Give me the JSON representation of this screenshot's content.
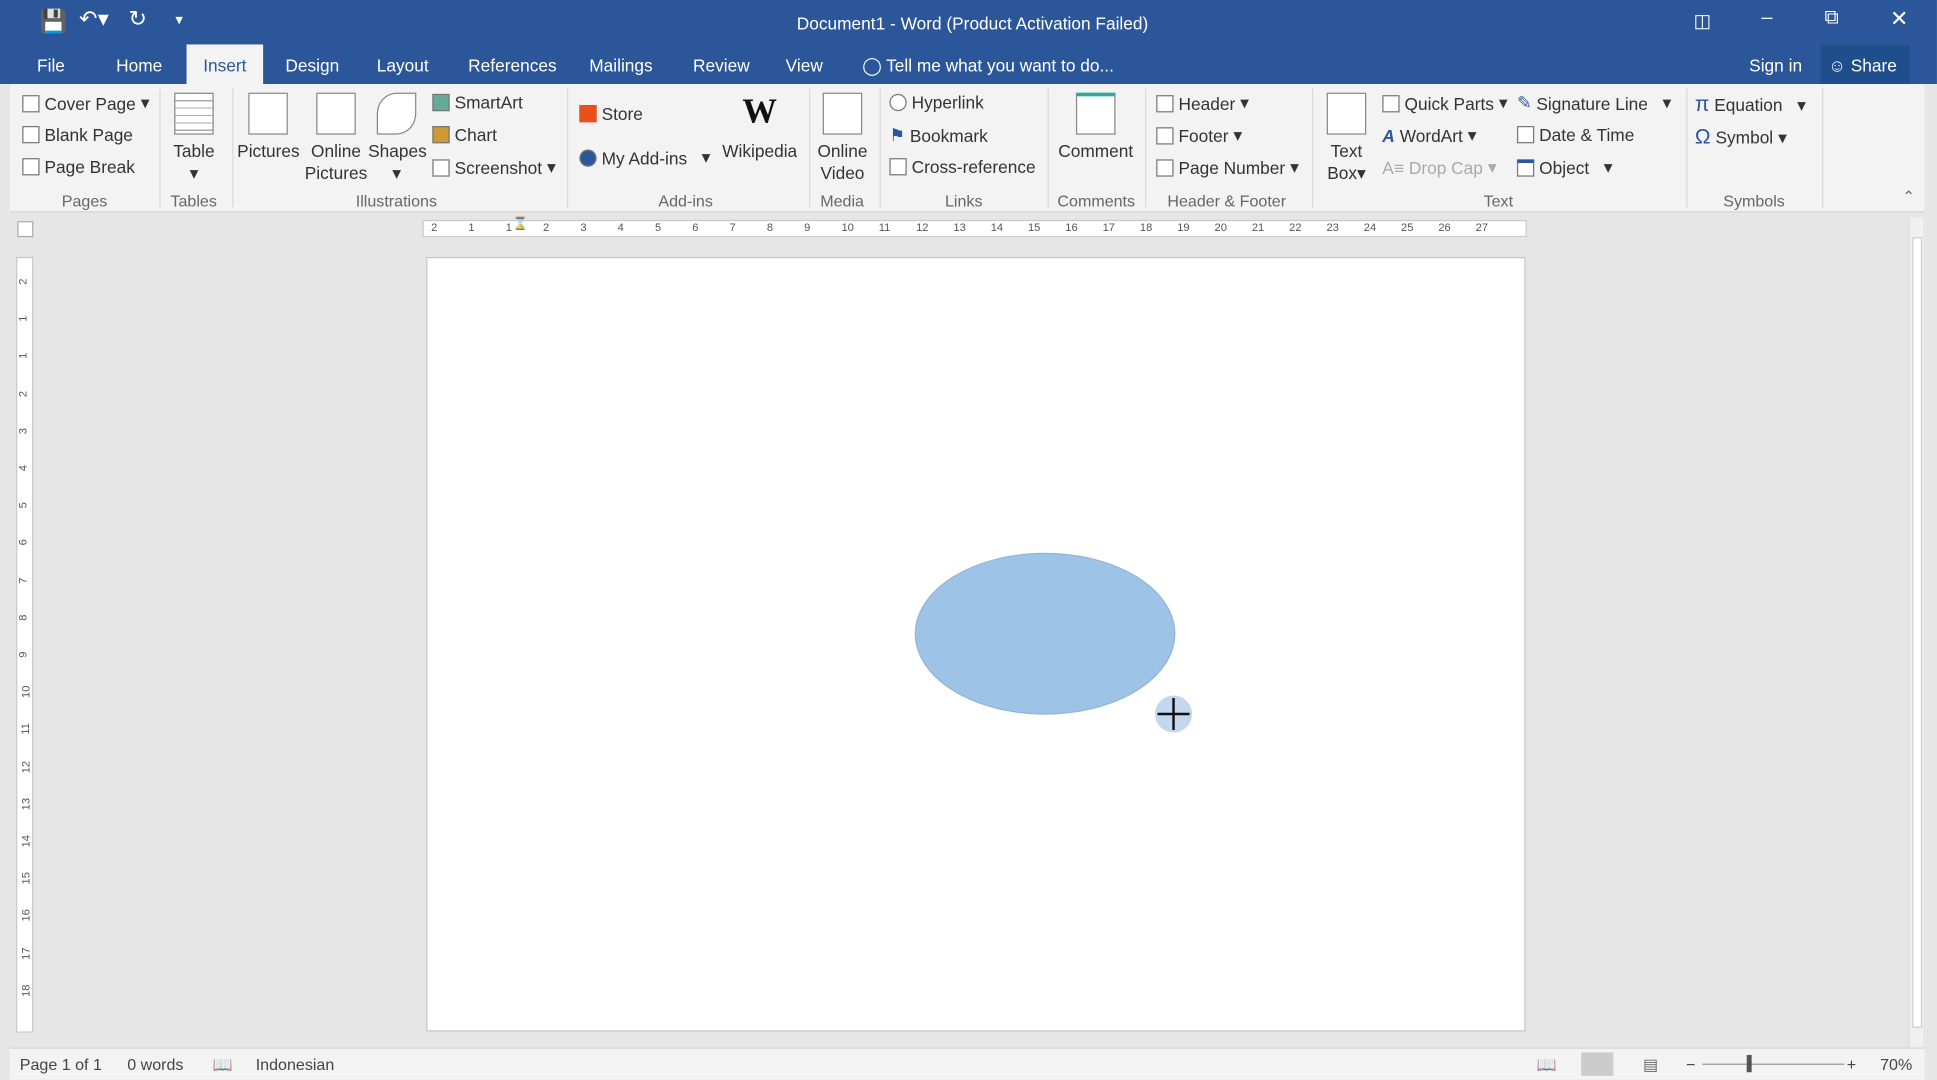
{
  "window": {
    "title": "Document1 - Word (Product Activation Failed)"
  },
  "quick_access": [
    "save-icon",
    "undo-icon",
    "redo-icon",
    "customize-icon"
  ],
  "tabs": [
    {
      "label": "File"
    },
    {
      "label": "Home"
    },
    {
      "label": "Insert",
      "active": true
    },
    {
      "label": "Design"
    },
    {
      "label": "Layout"
    },
    {
      "label": "References"
    },
    {
      "label": "Mailings"
    },
    {
      "label": "Review"
    },
    {
      "label": "View"
    }
  ],
  "tell_me": "Tell me what you want to do...",
  "sign_in": "Sign in",
  "share": "Share",
  "ribbon": {
    "pages": {
      "label": "Pages",
      "cover": "Cover Page",
      "blank": "Blank Page",
      "break": "Page Break"
    },
    "tables": {
      "label": "Tables",
      "table": "Table"
    },
    "illustrations": {
      "label": "Illustrations",
      "pictures": "Pictures",
      "online1": "Online",
      "online2": "Pictures",
      "shapes": "Shapes",
      "smartart": "SmartArt",
      "chart": "Chart",
      "screenshot": "Screenshot"
    },
    "addins": {
      "label": "Add-ins",
      "store": "Store",
      "myaddins": "My Add-ins",
      "wikipedia": "Wikipedia"
    },
    "media": {
      "label": "Media",
      "v1": "Online",
      "v2": "Video"
    },
    "links": {
      "label": "Links",
      "hyperlink": "Hyperlink",
      "bookmark": "Bookmark",
      "crossref": "Cross-reference"
    },
    "comments": {
      "label": "Comments",
      "comment": "Comment"
    },
    "hf": {
      "label": "Header & Footer",
      "header": "Header",
      "footer": "Footer",
      "pagenum": "Page Number"
    },
    "text": {
      "label": "Text",
      "tb1": "Text",
      "tb2": "Box",
      "quickparts": "Quick Parts",
      "wordart": "WordArt",
      "dropcap": "Drop Cap",
      "sigline": "Signature Line",
      "datetime": "Date & Time",
      "object": "Object"
    },
    "symbols": {
      "label": "Symbols",
      "equation": "Equation",
      "symbol": "Symbol"
    }
  },
  "ruler": {
    "h_ticks": [
      "2",
      "1",
      "1",
      "2",
      "3",
      "4",
      "5",
      "6",
      "7",
      "8",
      "9",
      "10",
      "11",
      "12",
      "13",
      "14",
      "15",
      "16",
      "17",
      "18",
      "19",
      "20",
      "21",
      "22",
      "23",
      "24",
      "25",
      "26",
      "27"
    ],
    "v_ticks": [
      "2",
      "1",
      "1",
      "2",
      "3",
      "4",
      "5",
      "6",
      "7",
      "8",
      "9",
      "10",
      "11",
      "12",
      "13",
      "14",
      "15",
      "16",
      "17",
      "18"
    ]
  },
  "document": {
    "shape": "oval",
    "shape_fill": "#9dc3e6"
  },
  "status": {
    "page": "Page 1 of 1",
    "words": "0 words",
    "language": "Indonesian",
    "zoom": "70%",
    "zoom_percent": 70
  },
  "colors": {
    "accent": "#2b579a"
  }
}
